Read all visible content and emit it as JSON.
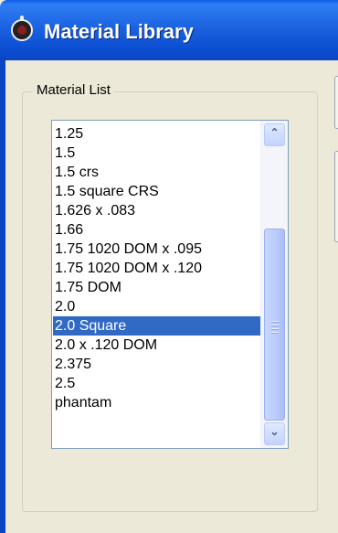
{
  "window": {
    "title": "Material Library",
    "icon": "app-logo-icon"
  },
  "group": {
    "label": "Material List"
  },
  "list": {
    "items": [
      "1.25",
      "1.5",
      "1.5 crs",
      "1.5 square CRS",
      "1.626 x .083",
      "1.66",
      "1.75 1020 DOM x .095",
      "1.75 1020 DOM x .120",
      "1.75 DOM",
      "2.0",
      "2.0 Square",
      "2.0 x .120 DOM",
      "2.375",
      "2.5",
      "phantam"
    ],
    "selected": "2.0 Square"
  },
  "scrollbar": {
    "up_glyph": "⌃",
    "down_glyph": "⌄"
  },
  "colors": {
    "titlebar": "#0a46c4",
    "selection": "#316ac5",
    "dialog_bg": "#ece9d8"
  }
}
